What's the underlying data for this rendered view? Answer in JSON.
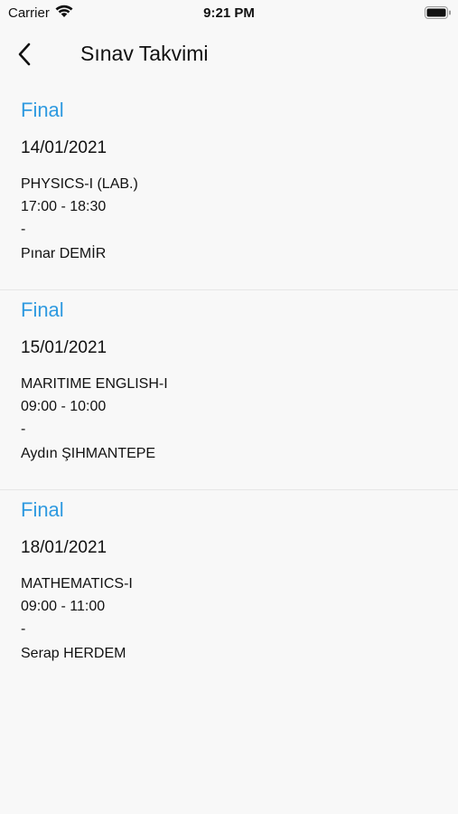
{
  "status_bar": {
    "carrier": "Carrier",
    "time": "9:21 PM"
  },
  "nav": {
    "title": "Sınav Takvimi"
  },
  "exams": [
    {
      "type": "Final",
      "date": "14/01/2021",
      "course": "PHYSICS-I (LAB.)",
      "time": "17:00 - 18:30",
      "room": "-",
      "instructor": "Pınar DEMİR"
    },
    {
      "type": "Final",
      "date": "15/01/2021",
      "course": "MARITIME ENGLISH-I",
      "time": "09:00 - 10:00",
      "room": "-",
      "instructor": "Aydın ŞIHMANTEPE"
    },
    {
      "type": "Final",
      "date": "18/01/2021",
      "course": "MATHEMATICS-I",
      "time": "09:00 - 11:00",
      "room": "-",
      "instructor": "Serap HERDEM"
    }
  ],
  "colors": {
    "accent": "#2f9ae0",
    "background": "#f8f8f8",
    "divider": "#e6e6e6"
  }
}
